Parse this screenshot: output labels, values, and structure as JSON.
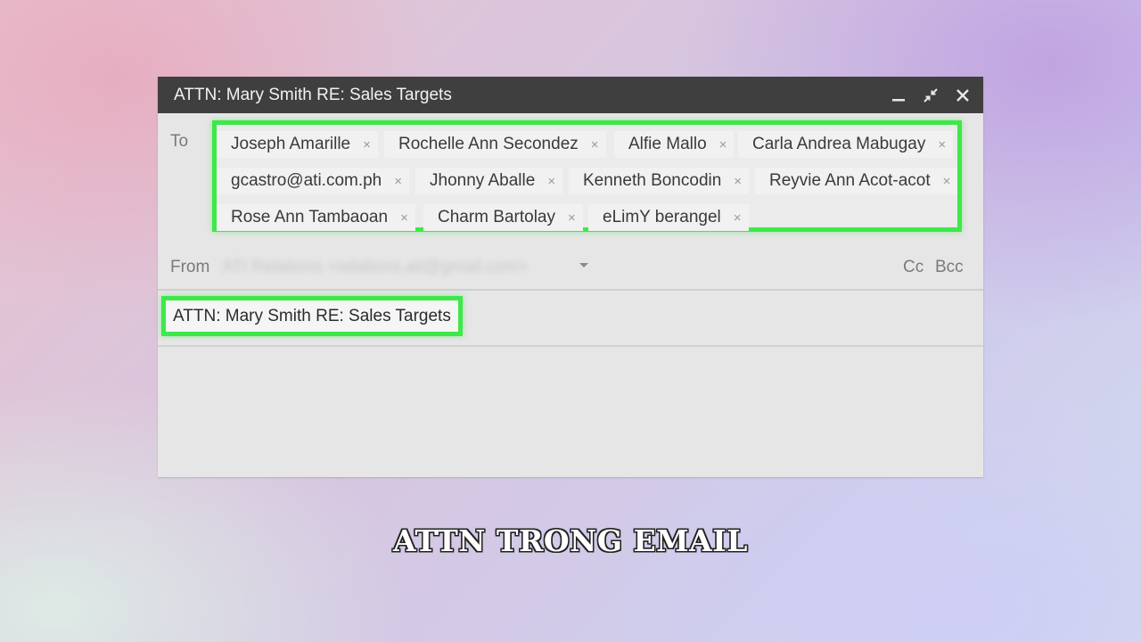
{
  "window": {
    "title": "ATTN: Mary Smith RE: Sales Targets",
    "controls": [
      "minimize-icon",
      "exit-fullscreen-icon",
      "close-icon"
    ]
  },
  "to": {
    "label": "To",
    "recipients": [
      "Joseph Amarille",
      "Rochelle Ann Secondez",
      "Alfie Mallo",
      "Carla Andrea Mabugay",
      "gcastro@ati.com.ph",
      "Jhonny Aballe",
      "Kenneth Boncodin",
      "Reyvie Ann Acot-acot",
      "Rose Ann Tambaoan",
      "Charm Bartolay",
      "eLimY berangel"
    ],
    "remove_symbol": "×"
  },
  "from": {
    "label": "From",
    "value": "ATI Relations <relations.ati@gmail.com>",
    "cc": "Cc",
    "bcc": "Bcc"
  },
  "subject": {
    "value": "ATTN: Mary Smith RE: Sales Targets"
  },
  "highlight_color": "#3ee84a",
  "caption": "ATTN TRONG EMAIL"
}
